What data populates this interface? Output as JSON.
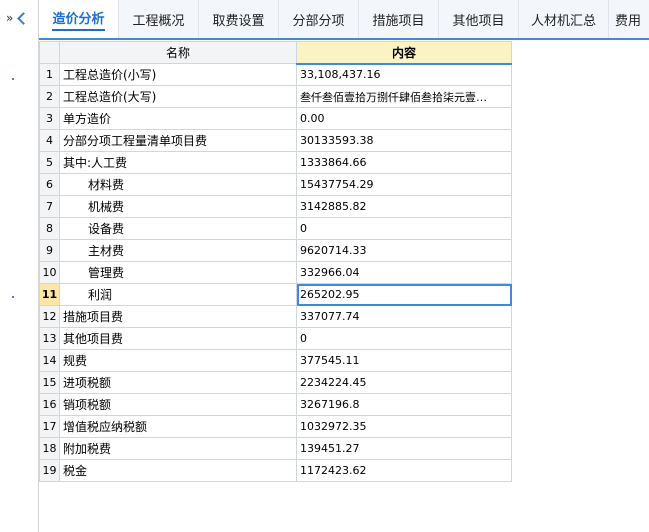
{
  "tabs": [
    {
      "label": "造价分析",
      "active": true
    },
    {
      "label": "工程概况",
      "active": false
    },
    {
      "label": "取费设置",
      "active": false
    },
    {
      "label": "分部分项",
      "active": false
    },
    {
      "label": "措施项目",
      "active": false
    },
    {
      "label": "其他项目",
      "active": false
    },
    {
      "label": "人材机汇总",
      "active": false
    },
    {
      "label": "费用",
      "active": false
    }
  ],
  "colors": {
    "accent": "#3d8bd9",
    "header_highlight": "#fbf3c4",
    "row_highlight": "#fde7a6"
  },
  "table": {
    "headers": {
      "name": "名称",
      "content": "内容"
    },
    "selected_row": 11,
    "rows": [
      {
        "no": "1",
        "name": "工程总造价(小写)",
        "value": "33,108,437.16"
      },
      {
        "no": "2",
        "name": "工程总造价(大写)",
        "value": "叁仟叁佰壹拾万捌仟肆佰叁拾柒元壹…"
      },
      {
        "no": "3",
        "name": "单方造价",
        "value": "0.00"
      },
      {
        "no": "4",
        "name": "分部分项工程量清单项目费",
        "value": "30133593.38"
      },
      {
        "no": "5",
        "name": "其中:人工费",
        "value": "1333864.66"
      },
      {
        "no": "6",
        "name": "材料费",
        "value": "15437754.29"
      },
      {
        "no": "7",
        "name": "机械费",
        "value": "3142885.82"
      },
      {
        "no": "8",
        "name": "设备费",
        "value": "0"
      },
      {
        "no": "9",
        "name": "主材费",
        "value": "9620714.33"
      },
      {
        "no": "10",
        "name": "管理费",
        "value": "332966.04"
      },
      {
        "no": "11",
        "name": "利润",
        "value": "265202.95"
      },
      {
        "no": "12",
        "name": "措施项目费",
        "value": "337077.74"
      },
      {
        "no": "13",
        "name": "其他项目费",
        "value": "0"
      },
      {
        "no": "14",
        "name": "规费",
        "value": "377545.11"
      },
      {
        "no": "15",
        "name": "进项税额",
        "value": "2234224.45"
      },
      {
        "no": "16",
        "name": "销项税额",
        "value": "3267196.8"
      },
      {
        "no": "17",
        "name": "增值税应纳税额",
        "value": "1032972.35"
      },
      {
        "no": "18",
        "name": "附加税费",
        "value": "139451.27"
      },
      {
        "no": "19",
        "name": "税金",
        "value": "1172423.62"
      }
    ]
  }
}
